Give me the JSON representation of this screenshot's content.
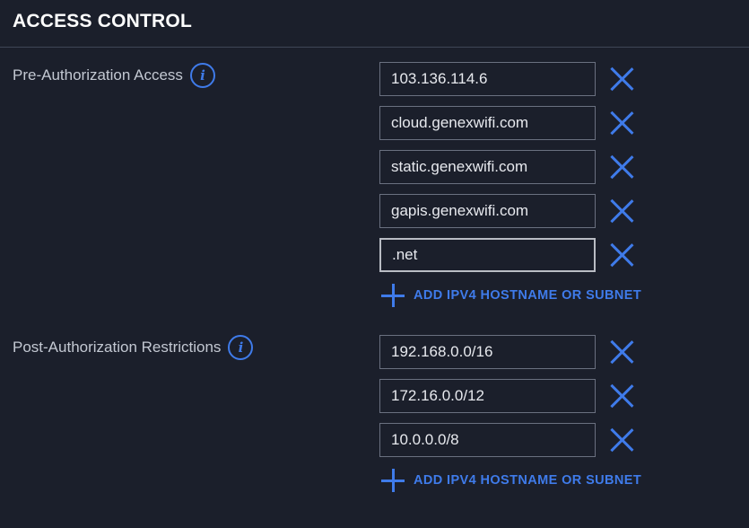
{
  "title": "ACCESS CONTROL",
  "colors": {
    "background": "#1b1f2b",
    "accent": "#3f7bea",
    "input_border": "#6a7080"
  },
  "pre_auth": {
    "label": "Pre-Authorization Access",
    "info_icon": "i",
    "entries": [
      "103.136.114.6",
      "cloud.genexwifi.com",
      "static.genexwifi.com",
      "gapis.genexwifi.com",
      ".net"
    ],
    "add_label": "ADD IPV4 HOSTNAME OR SUBNET"
  },
  "post_auth": {
    "label": "Post-Authorization Restrictions",
    "info_icon": "i",
    "entries": [
      "192.168.0.0/16",
      "172.16.0.0/12",
      "10.0.0.0/8"
    ],
    "add_label": "ADD IPV4 HOSTNAME OR SUBNET"
  }
}
